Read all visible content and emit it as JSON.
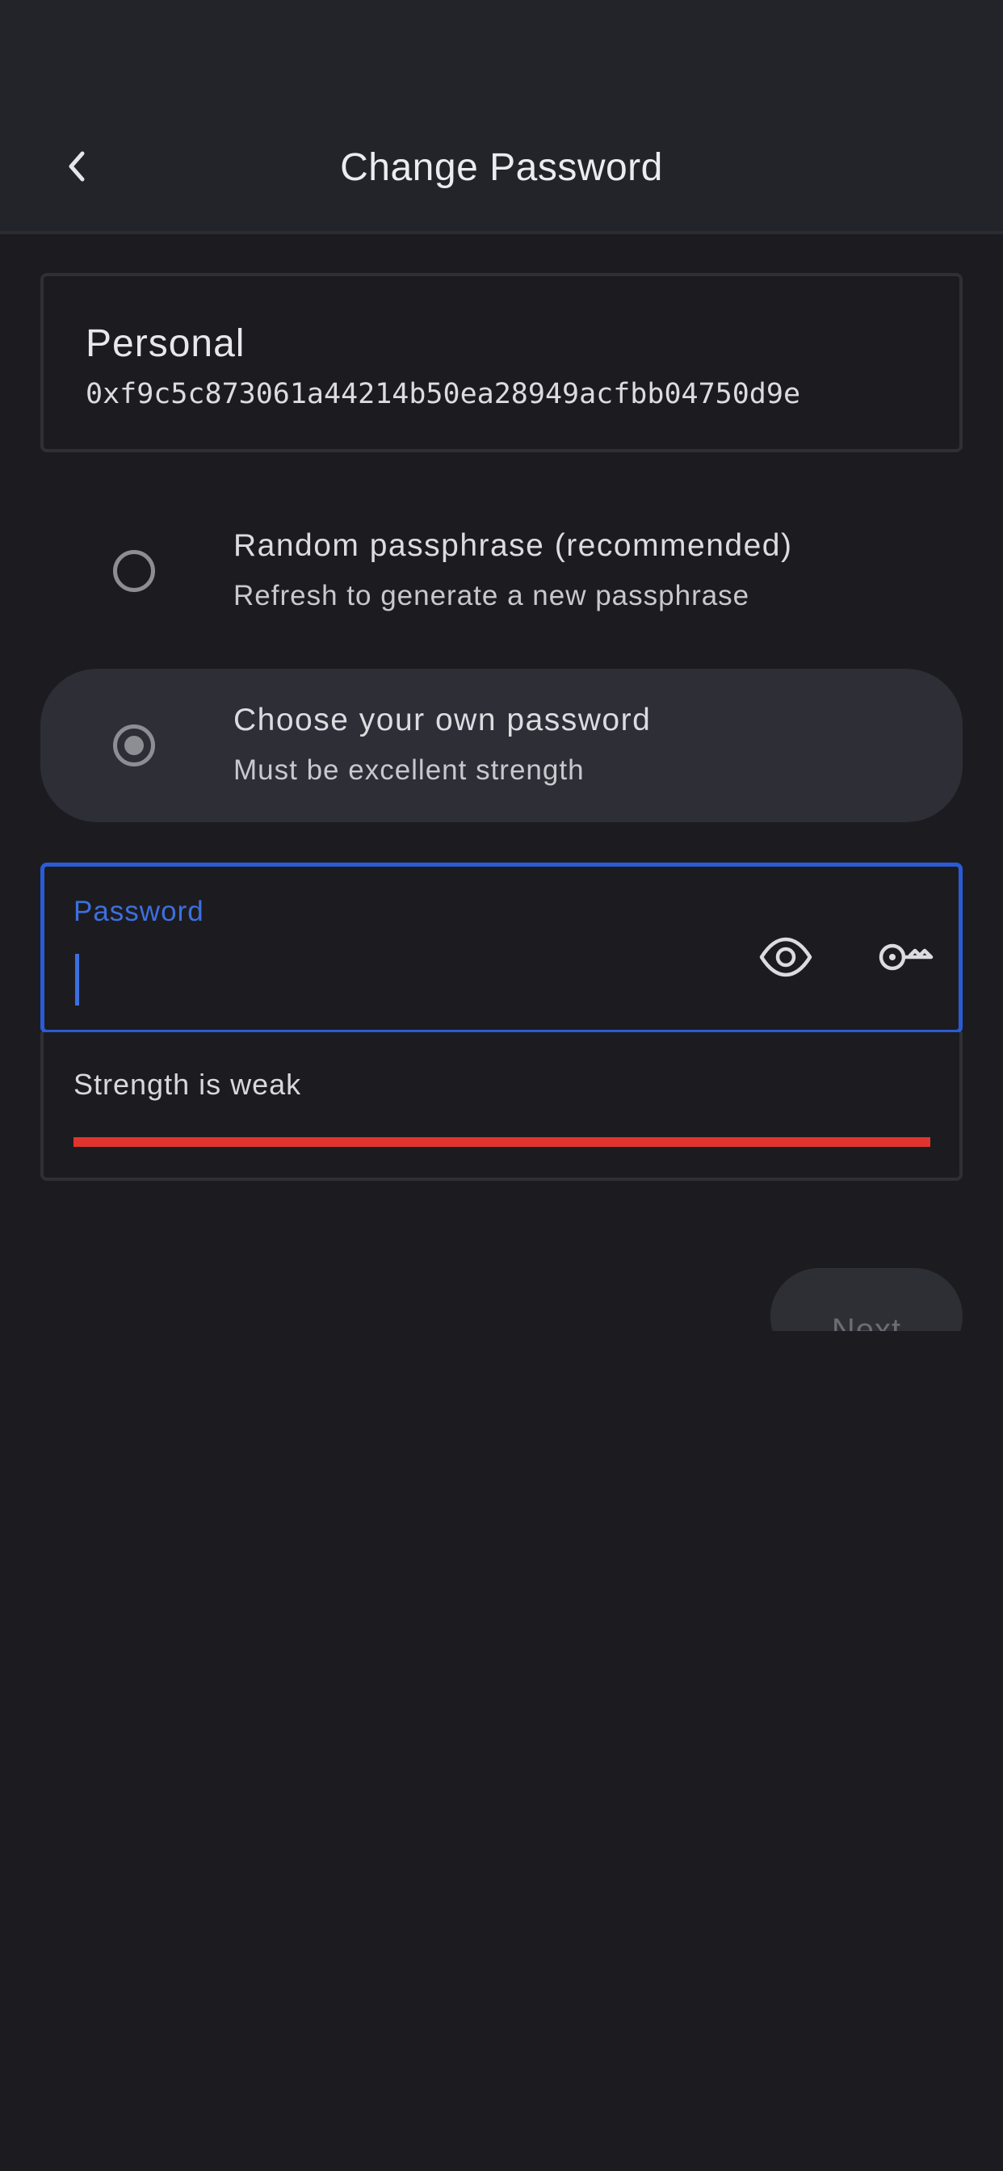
{
  "header": {
    "title": "Change Password"
  },
  "account": {
    "name": "Personal",
    "address": "0xf9c5c873061a44214b50ea28949acfbb04750d9e"
  },
  "options": [
    {
      "title": "Random passphrase (recommended)",
      "subtitle": "Refresh to generate a new passphrase",
      "selected": false
    },
    {
      "title": "Choose your own password",
      "subtitle": "Must be excellent strength",
      "selected": true
    }
  ],
  "password_field": {
    "label": "Password",
    "value": ""
  },
  "strength": {
    "text": "Strength is weak",
    "level": 1.0,
    "color": "#e0342f"
  },
  "actions": {
    "next_label": "Next"
  },
  "colors": {
    "accent": "#2a5bd7",
    "background": "#1c1c20",
    "header": "#232429",
    "selected_option": "#2d2e36"
  }
}
